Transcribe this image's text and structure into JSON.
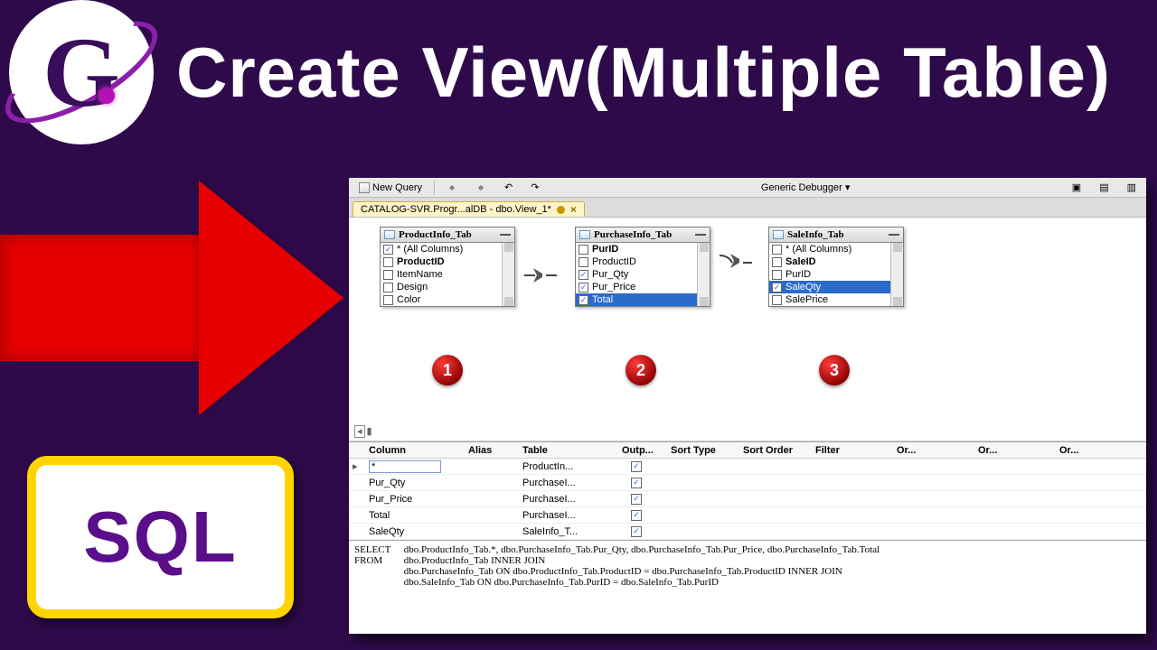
{
  "header": {
    "title": "Create View(Multiple Table)"
  },
  "badge": {
    "sql": "SQL"
  },
  "toolbar": {
    "new_query": "New Query",
    "debugger": "Generic Debugger"
  },
  "doc_tab": {
    "label": "CATALOG-SVR.Progr...alDB - dbo.View_1*"
  },
  "tables": [
    {
      "title": "ProductInfo_Tab",
      "badge": "1",
      "cols": [
        {
          "label": "* (All Columns)",
          "checked": true,
          "bold": false,
          "sel": false
        },
        {
          "label": "ProductID",
          "checked": false,
          "bold": true,
          "sel": false
        },
        {
          "label": "ItemName",
          "checked": false,
          "bold": false,
          "sel": false
        },
        {
          "label": "Design",
          "checked": false,
          "bold": false,
          "sel": false
        },
        {
          "label": "Color",
          "checked": false,
          "bold": false,
          "sel": false
        }
      ]
    },
    {
      "title": "PurchaseInfo_Tab",
      "badge": "2",
      "cols": [
        {
          "label": "PurID",
          "checked": false,
          "bold": true,
          "sel": false
        },
        {
          "label": "ProductID",
          "checked": false,
          "bold": false,
          "sel": false
        },
        {
          "label": "Pur_Qty",
          "checked": true,
          "bold": false,
          "sel": false
        },
        {
          "label": "Pur_Price",
          "checked": true,
          "bold": false,
          "sel": false
        },
        {
          "label": "Total",
          "checked": true,
          "bold": false,
          "sel": true
        }
      ]
    },
    {
      "title": "SaleInfo_Tab",
      "badge": "3",
      "cols": [
        {
          "label": "* (All Columns)",
          "checked": false,
          "bold": false,
          "sel": false
        },
        {
          "label": "SaleID",
          "checked": false,
          "bold": true,
          "sel": false
        },
        {
          "label": "PurID",
          "checked": false,
          "bold": false,
          "sel": false
        },
        {
          "label": "SaleQty",
          "checked": true,
          "bold": false,
          "sel": true
        },
        {
          "label": "SalePrice",
          "checked": false,
          "bold": false,
          "sel": false
        }
      ]
    }
  ],
  "grid": {
    "headers": [
      "Column",
      "Alias",
      "Table",
      "Outp...",
      "Sort Type",
      "Sort Order",
      "Filter",
      "Or...",
      "Or...",
      "Or..."
    ],
    "rows": [
      {
        "column": "*",
        "table": "ProductIn...",
        "out": true,
        "editing": true
      },
      {
        "column": "Pur_Qty",
        "table": "PurchaseI...",
        "out": true
      },
      {
        "column": "Pur_Price",
        "table": "PurchaseI...",
        "out": true
      },
      {
        "column": "Total",
        "table": "PurchaseI...",
        "out": true
      },
      {
        "column": "SaleQty",
        "table": "SaleInfo_T...",
        "out": true
      }
    ]
  },
  "sql": {
    "select_kw": "SELECT",
    "from_kw": "FROM",
    "select_body": "dbo.ProductInfo_Tab.*, dbo.PurchaseInfo_Tab.Pur_Qty, dbo.PurchaseInfo_Tab.Pur_Price, dbo.PurchaseInfo_Tab.Total",
    "from_line1": "dbo.ProductInfo_Tab INNER JOIN",
    "from_line2": "dbo.PurchaseInfo_Tab ON dbo.ProductInfo_Tab.ProductID = dbo.PurchaseInfo_Tab.ProductID INNER JOIN",
    "from_line3": "dbo.SaleInfo_Tab ON dbo.PurchaseInfo_Tab.PurID = dbo.SaleInfo_Tab.PurID"
  }
}
